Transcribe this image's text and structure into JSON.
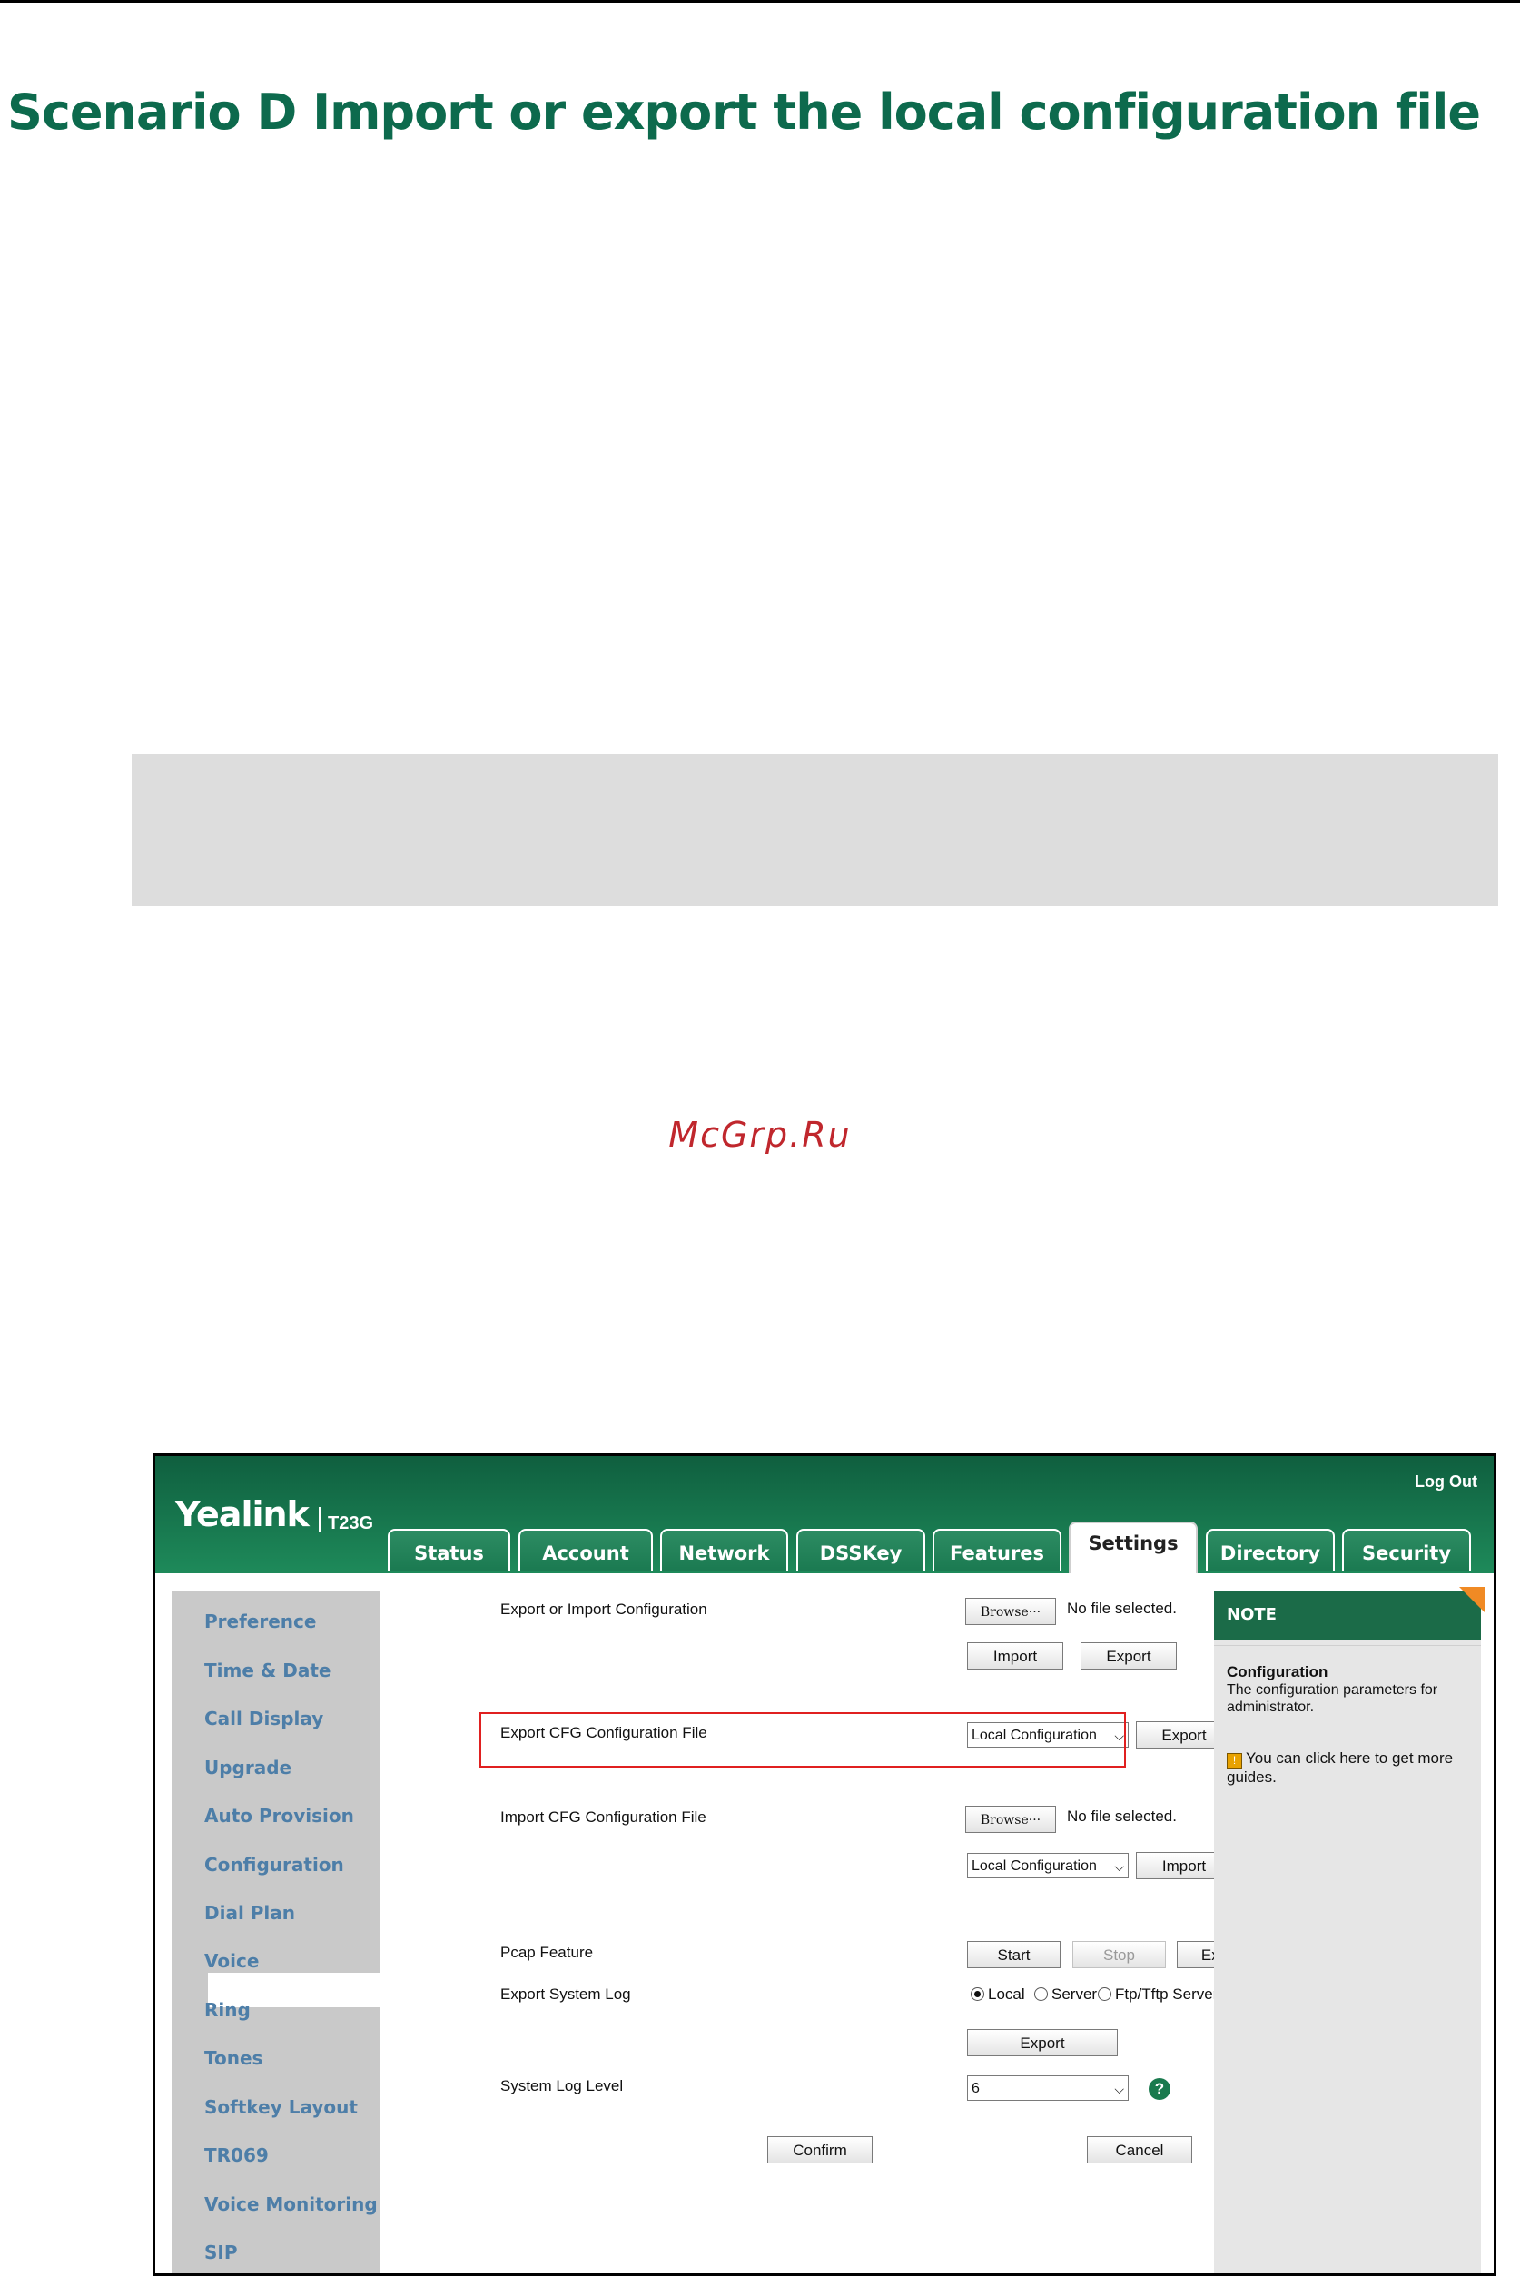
{
  "document": {
    "title": "Scenario D Import or export the local configuration file",
    "watermark": "McGrp.Ru"
  },
  "web_ui": {
    "brand": "Yealink",
    "model": "T23G",
    "log_out": "Log Out",
    "tabs": [
      "Status",
      "Account",
      "Network",
      "DSSKey",
      "Features",
      "Settings",
      "Directory",
      "Security"
    ],
    "active_tab": "Settings",
    "sidebar": [
      "Preference",
      "Time & Date",
      "Call Display",
      "Upgrade",
      "Auto Provision",
      "Configuration",
      "Dial Plan",
      "Voice",
      "Ring",
      "Tones",
      "Softkey Layout",
      "TR069",
      "Voice Monitoring",
      "SIP"
    ],
    "active_sidebar": "Configuration",
    "form": {
      "export_import_label": "Export or Import Configuration",
      "browse": "Browse···",
      "no_file": "No file selected.",
      "import": "Import",
      "export": "Export",
      "export_cfg_label": "Export CFG Configuration File",
      "local_config_option": "Local Configuration",
      "import_cfg_label": "Import CFG Configuration File",
      "pcap_label": "Pcap Feature",
      "start": "Start",
      "stop": "Stop",
      "syslog_label": "Export System Log",
      "radio_local": "Local",
      "radio_server": "Server",
      "radio_ftp": "Ftp/Tftp Server",
      "selected_radio": "Local",
      "log_level_label": "System Log Level",
      "log_level_value": "6",
      "confirm": "Confirm",
      "cancel": "Cancel",
      "help": "?"
    },
    "note": {
      "header": "NOTE",
      "title": "Configuration",
      "text": "The configuration parameters for administrator.",
      "guide": "You can click here to get more guides."
    }
  }
}
